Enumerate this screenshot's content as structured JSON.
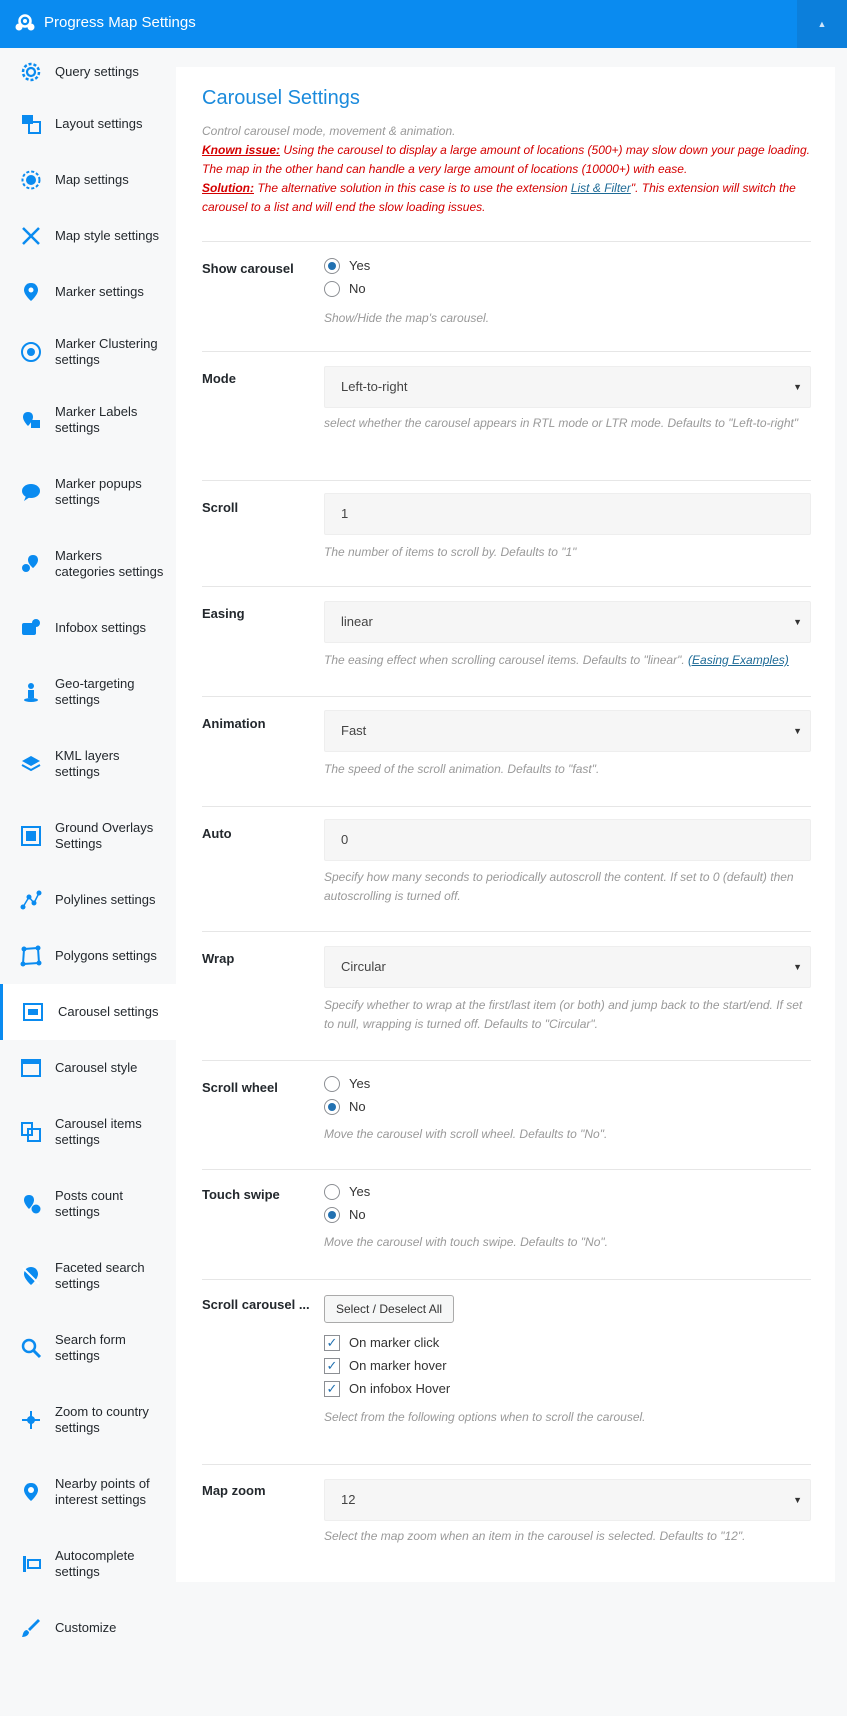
{
  "header": {
    "title": "Progress Map Settings",
    "toggle_icon": "▲"
  },
  "sidebar": {
    "items": [
      {
        "label": "Query settings",
        "icon": "gear-icon"
      },
      {
        "label": "Layout settings",
        "icon": "layout-icon"
      },
      {
        "label": "Map settings",
        "icon": "map-gear-icon"
      },
      {
        "label": "Map style settings",
        "icon": "tools-icon"
      },
      {
        "label": "Marker settings",
        "icon": "marker-icon"
      },
      {
        "label": "Marker Clustering settings",
        "icon": "cluster-icon"
      },
      {
        "label": "Marker Labels settings",
        "icon": "marker-label-icon"
      },
      {
        "label": "Marker popups settings",
        "icon": "popup-icon"
      },
      {
        "label": "Markers categories settings",
        "icon": "markers-icon"
      },
      {
        "label": "Infobox settings",
        "icon": "infobox-icon"
      },
      {
        "label": "Geo-targeting settings",
        "icon": "person-pin-icon"
      },
      {
        "label": "KML layers settings",
        "icon": "layers-icon"
      },
      {
        "label": "Ground Overlays Settings",
        "icon": "overlay-icon"
      },
      {
        "label": "Polylines settings",
        "icon": "polyline-icon"
      },
      {
        "label": "Polygons settings",
        "icon": "polygon-icon"
      },
      {
        "label": "Carousel settings",
        "icon": "carousel-icon",
        "active": true
      },
      {
        "label": "Carousel style",
        "icon": "carousel-style-icon"
      },
      {
        "label": "Carousel items settings",
        "icon": "carousel-items-icon"
      },
      {
        "label": "Posts count settings",
        "icon": "posts-count-icon"
      },
      {
        "label": "Faceted search settings",
        "icon": "faceted-search-icon"
      },
      {
        "label": "Search form settings",
        "icon": "search-icon"
      },
      {
        "label": "Zoom to country settings",
        "icon": "zoom-country-icon"
      },
      {
        "label": "Nearby points of interest settings",
        "icon": "poi-icon"
      },
      {
        "label": "Autocomplete settings",
        "icon": "autocomplete-icon"
      },
      {
        "label": "Customize",
        "icon": "brush-icon"
      }
    ]
  },
  "main": {
    "title": "Carousel Settings",
    "intro": {
      "description": "Control carousel mode, movement & animation.",
      "known_issue_label": "Known issue:",
      "known_issue_text": " Using the carousel to display a large amount of locations (500+) may slow down your page loading. The map in the other hand can handle a very large amount of locations (10000+) with ease.",
      "solution_label": "Solution:",
      "solution_text_before": " The alternative solution in this case is to use the extension ",
      "solution_link": "List & Filter",
      "solution_text_after": "\". This extension will switch the carousel to a list and will end the slow loading issues."
    },
    "show_carousel": {
      "label": "Show carousel",
      "options": [
        "Yes",
        "No"
      ],
      "selected": "Yes",
      "help": "Show/Hide the map's carousel."
    },
    "mode": {
      "label": "Mode",
      "value": "Left-to-right",
      "help": "select whether the carousel appears in RTL mode or LTR mode. Defaults to \"Left-to-right\""
    },
    "scroll": {
      "label": "Scroll",
      "value": "1",
      "help": "The number of items to scroll by. Defaults to \"1\""
    },
    "easing": {
      "label": "Easing",
      "value": "linear",
      "help": "The easing effect when scrolling carousel items. Defaults to \"linear\". ",
      "help_link": "(Easing Examples)"
    },
    "animation": {
      "label": "Animation",
      "value": "Fast",
      "help": "The speed of the scroll animation. Defaults to \"fast\"."
    },
    "auto": {
      "label": "Auto",
      "value": "0",
      "help": "Specify how many seconds to periodically autoscroll the content. If set to 0 (default) then autoscrolling is turned off."
    },
    "wrap": {
      "label": "Wrap",
      "value": "Circular",
      "help": "Specify whether to wrap at the first/last item (or both) and jump back to the start/end. If set to null, wrapping is turned off. Defaults to \"Circular\"."
    },
    "scroll_wheel": {
      "label": "Scroll wheel",
      "options": [
        "Yes",
        "No"
      ],
      "selected": "No",
      "help": "Move the carousel with scroll wheel. Defaults to \"No\"."
    },
    "touch_swipe": {
      "label": "Touch swipe",
      "options": [
        "Yes",
        "No"
      ],
      "selected": "No",
      "help": "Move the carousel with touch swipe. Defaults to \"No\"."
    },
    "scroll_carousel": {
      "label": "Scroll carousel ...",
      "button": "Select / Deselect All",
      "options": [
        "On marker click",
        "On marker hover",
        "On infobox Hover"
      ],
      "help": "Select from the following options when to scroll the carousel."
    },
    "map_zoom": {
      "label": "Map zoom",
      "value": "12",
      "help": "Select the map zoom when an item in the carousel is selected. Defaults to \"12\"."
    },
    "select_arrow": "▼"
  },
  "colors": {
    "header": "#0a8bf0",
    "accent": "#1a8adc",
    "warning": "#d40000"
  }
}
